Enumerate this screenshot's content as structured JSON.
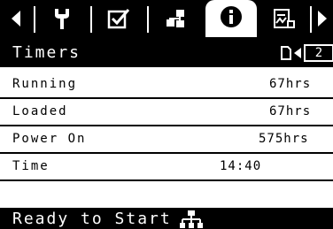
{
  "tabs": [
    {
      "icon": "left-arrow-icon"
    },
    {
      "icon": "wrench-icon"
    },
    {
      "icon": "checklist-icon"
    },
    {
      "icon": "network-icon"
    },
    {
      "icon": "info-icon",
      "active": true
    },
    {
      "icon": "settings-document-icon"
    },
    {
      "icon": "right-arrow-icon"
    }
  ],
  "header": {
    "title": "Timers",
    "page_number": "2"
  },
  "rows": [
    {
      "label": "Running",
      "value": "67hrs"
    },
    {
      "label": "Loaded",
      "value": "67hrs"
    },
    {
      "label": "Power On",
      "value": "575hrs"
    },
    {
      "label": "Time",
      "value": "14:40"
    },
    {
      "label": "",
      "value": ""
    }
  ],
  "status": {
    "text": "Ready to Start",
    "icon": "network-icon"
  }
}
